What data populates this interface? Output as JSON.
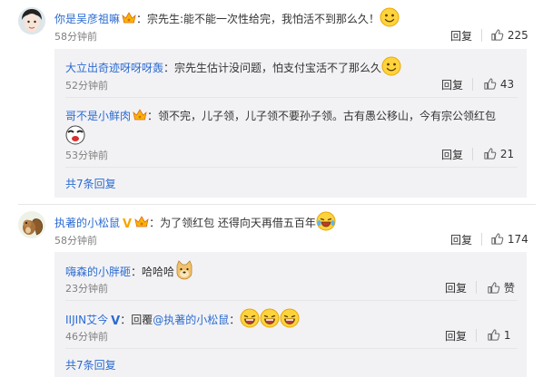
{
  "comments": [
    {
      "user": "你是吴彦祖嘛",
      "text": "：宗先生:能不能一次性给完，我怕活不到那么久！",
      "time": "58分钟前",
      "reply_label": "回复",
      "likes": "225",
      "replies": [
        {
          "user": "大立出奇迹呀呀呀轰",
          "text": "：宗先生估计没问题，怕支付宝活不了那么久",
          "time": "52分钟前",
          "reply_label": "回复",
          "likes": "43"
        },
        {
          "user": "哥不是小鲜肉",
          "text": "：领不完，儿子领，儿子领不要孙子领。古有愚公移山，今有宗公领红包",
          "time": "53分钟前",
          "reply_label": "回复",
          "likes": "21"
        }
      ],
      "more_label": "共7条回复"
    },
    {
      "user": "执著的小松鼠",
      "text": "：为了领红包 还得向天再借五百年",
      "time": "58分钟前",
      "reply_label": "回复",
      "likes": "174",
      "replies": [
        {
          "user": "嗨森的小胖砸",
          "text": "：哈哈哈",
          "time": "23分钟前",
          "reply_label": "回复",
          "likes": "赞"
        },
        {
          "user": "IIJIN艾今",
          "text_prefix": "：回覆",
          "mention": "@执著的小松鼠",
          "text_suffix": "：",
          "time": "46分钟前",
          "reply_label": "回复",
          "likes": "1"
        }
      ],
      "more_label": "共7条回复"
    }
  ],
  "colors": {
    "username_orange": "#eb7350",
    "username_blue": "#2b6bd0",
    "reply_bg": "#f2f2f5",
    "meta_gray": "#808080"
  }
}
